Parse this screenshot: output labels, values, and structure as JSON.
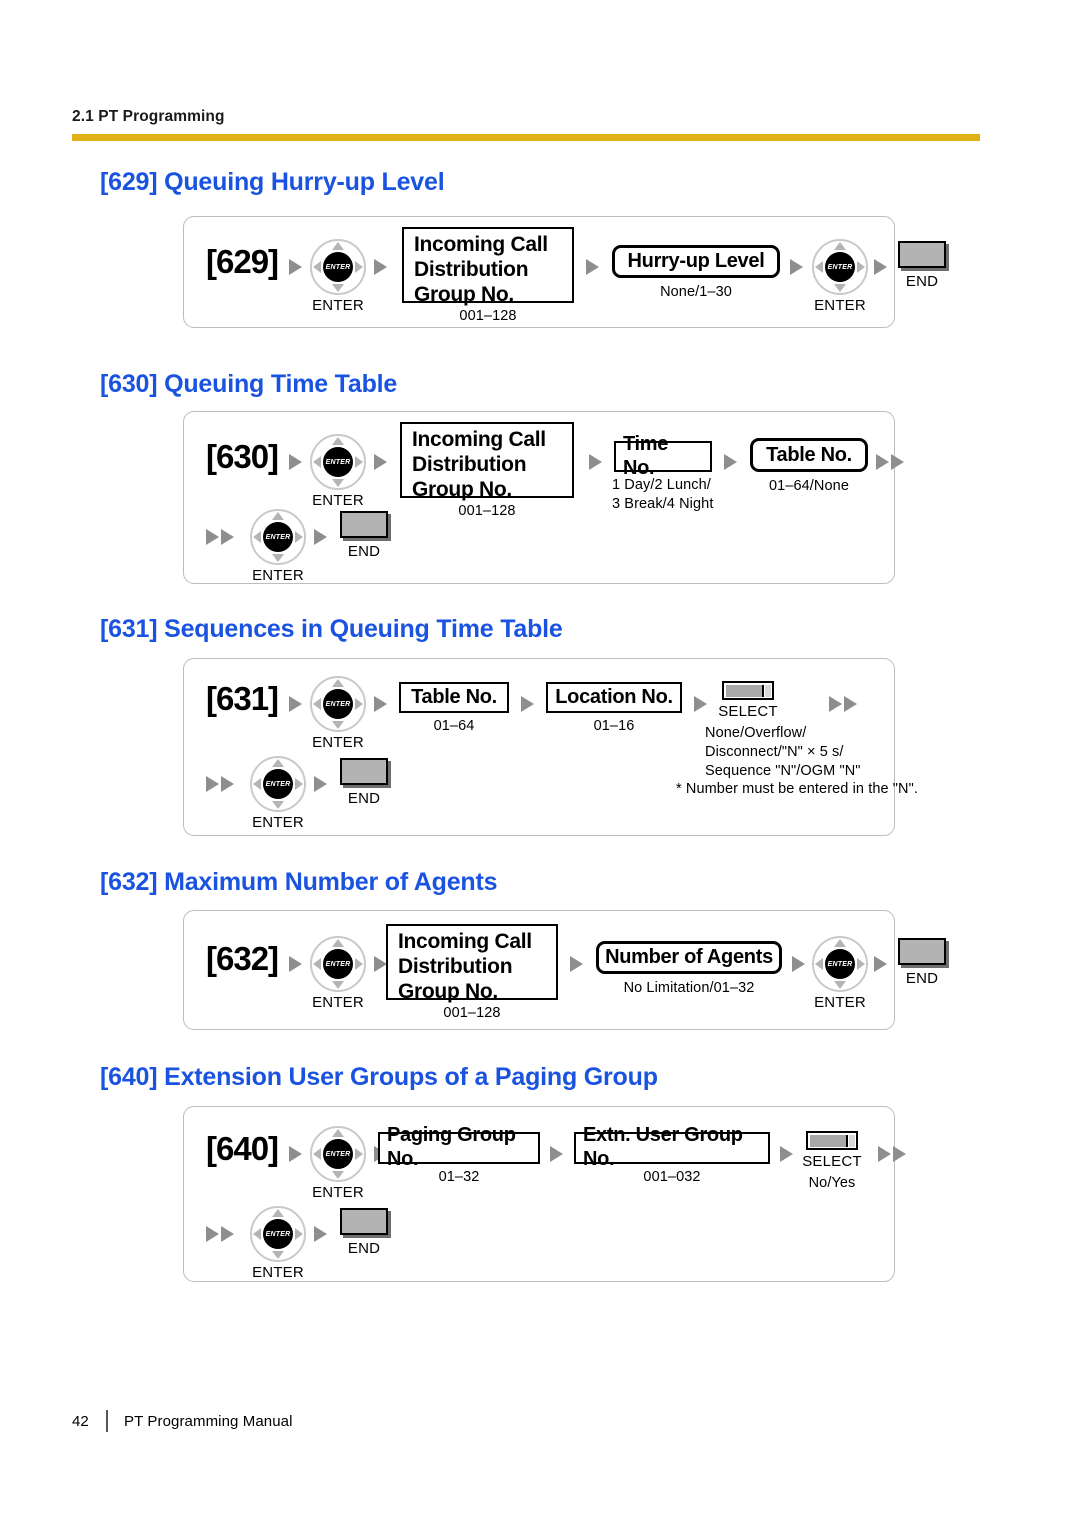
{
  "header": {
    "running_head": "2.1 PT Programming",
    "rule_color": "#e0b016"
  },
  "theme": {
    "heading_color": "#1a53e0",
    "panel_border": "#bdbdbd",
    "arrow_color": "#8e8e8e",
    "end_key_fill": "#b3b3b3",
    "select_key_fill": "#a8a8a8"
  },
  "labels": {
    "enter": "ENTER",
    "end": "END",
    "select": "SELECT",
    "enter_icon_text": "ENTER"
  },
  "sections": [
    {
      "id": "629",
      "title": "[629] Queuing Hurry-up Level",
      "prognum": "[629]",
      "box_main": "Incoming Call\nDistribution\nGroup No.",
      "box_main_range": "001–128",
      "value_box": "Hurry-up Level",
      "value_range": "None/1–30"
    },
    {
      "id": "630",
      "title": "[630] Queuing Time Table",
      "prognum": "[630]",
      "box_main": "Incoming Call\nDistribution\nGroup No.",
      "box_main_range": "001–128",
      "time_box": "Time No.",
      "time_range": "1 Day/2 Lunch/\n3 Break/4 Night",
      "table_box": "Table No.",
      "table_range": "01–64/None"
    },
    {
      "id": "631",
      "title": "[631] Sequences in Queuing Time Table",
      "prognum": "[631]",
      "table_box": "Table No.",
      "table_range": "01–64",
      "location_box": "Location No.",
      "location_range": "01–16",
      "select_options": "None/Overflow/\nDisconnect/\"N\" × 5 s/\nSequence \"N\"/OGM \"N\"",
      "footnote": "* Number must be entered in the \"N\"."
    },
    {
      "id": "632",
      "title": "[632] Maximum Number of Agents",
      "prognum": "[632]",
      "box_main": "Incoming Call\nDistribution\nGroup No.",
      "box_main_range": "001–128",
      "value_box": "Number of Agents",
      "value_range": "No Limitation/01–32"
    },
    {
      "id": "640",
      "title": "[640] Extension User Groups of a Paging Group",
      "prognum": "[640]",
      "paging_box": "Paging Group No.",
      "paging_range": "01–32",
      "extn_box": "Extn. User Group No.",
      "extn_range": "001–032",
      "select_options": "No/Yes"
    }
  ],
  "footer": {
    "page_number": "42",
    "manual_name": "PT Programming Manual"
  }
}
